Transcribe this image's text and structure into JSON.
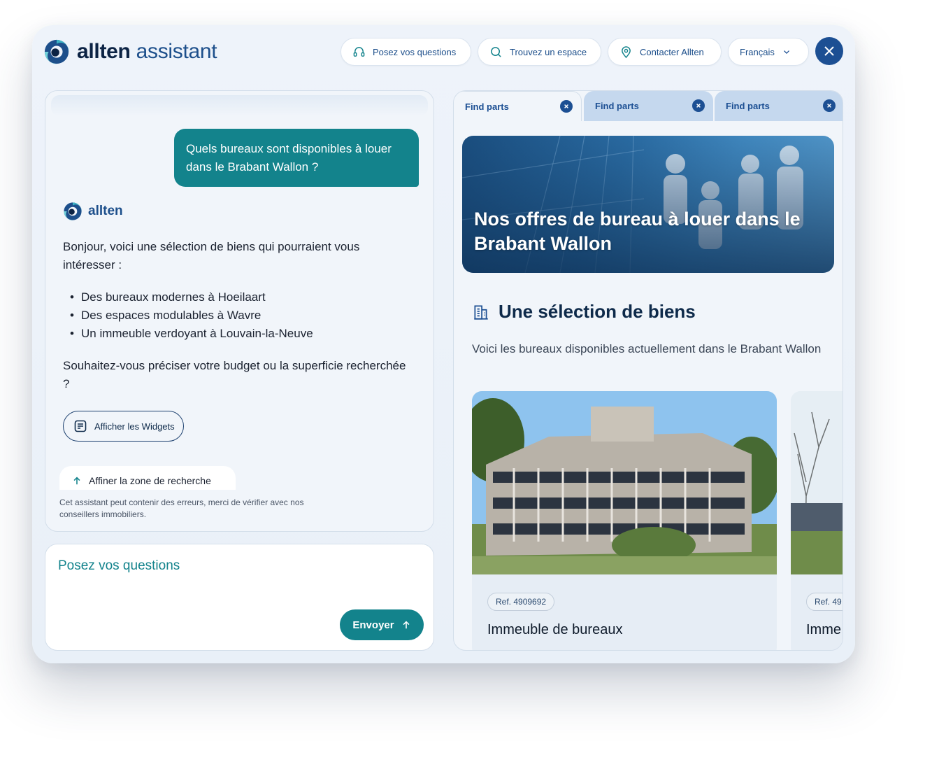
{
  "brand": {
    "name_part1": "allten",
    "name_part2": "assistant",
    "bot_name": "allten"
  },
  "header": {
    "nav": [
      {
        "label": "Posez vos questions",
        "icon": "headset-icon"
      },
      {
        "label": "Trouvez un espace",
        "icon": "search-icon"
      },
      {
        "label": "Contacter Allten",
        "icon": "location-pin-icon"
      },
      {
        "label": "Français",
        "icon": "chevron-down-icon"
      }
    ]
  },
  "chat": {
    "user_message": "Quels bureaux sont disponibles à louer dans le Brabant Wallon ?",
    "bot_intro": "Bonjour, voici une sélection de biens qui pourraient vous intéresser :",
    "bot_items": [
      "Des bureaux modernes à Hoeilaart",
      "Des espaces modulables à Wavre",
      "Un immeuble verdoyant à Louvain-la-Neuve"
    ],
    "bot_question": "Souhaitez-vous préciser votre budget ou la superficie recherchée ?",
    "widgets_button": "Afficher les Widgets",
    "suggestion": "Affiner la zone de recherche",
    "disclaimer": "Cet assistant peut contenir des erreurs, merci de vérifier avec nos conseillers immobiliers."
  },
  "input": {
    "placeholder": "Posez vos questions",
    "send_label": "Envoyer"
  },
  "panel": {
    "tabs": [
      "Find parts",
      "Find parts",
      "Find parts"
    ],
    "hero_title": "Nos offres de bureau à louer dans le Brabant Wallon",
    "section_title": "Une sélection de biens",
    "section_desc": "Voici les bureaux disponibles actuellement dans le Brabant Wallon",
    "cards": [
      {
        "ref": "Ref. 4909692",
        "title": "Immeuble de bureaux"
      },
      {
        "ref": "Ref. 49",
        "title": "Imme"
      }
    ]
  },
  "colors": {
    "primary": "#1c4f93",
    "teal": "#13838c",
    "navy": "#0e2a4a",
    "background": "#eef3fa"
  }
}
